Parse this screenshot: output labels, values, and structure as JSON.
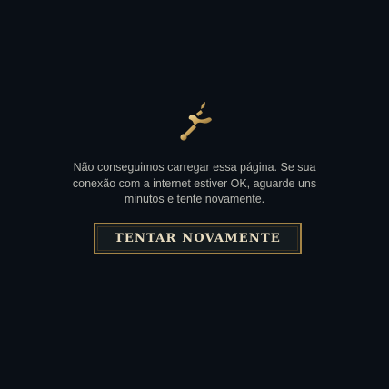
{
  "error": {
    "icon": "broken-sword-icon",
    "message": "Não conseguimos carregar essa página. Se sua\nconexão com a internet estiver OK, aguarde uns\nminutos e tente novamente.",
    "retry_label": "TENTAR NOVAMENTE"
  },
  "colors": {
    "background": "#0a0f16",
    "text": "#b7b7b0",
    "gold_border": "#a48446",
    "button_text": "#e8dcc0",
    "icon_gold": "#c8a25a"
  }
}
